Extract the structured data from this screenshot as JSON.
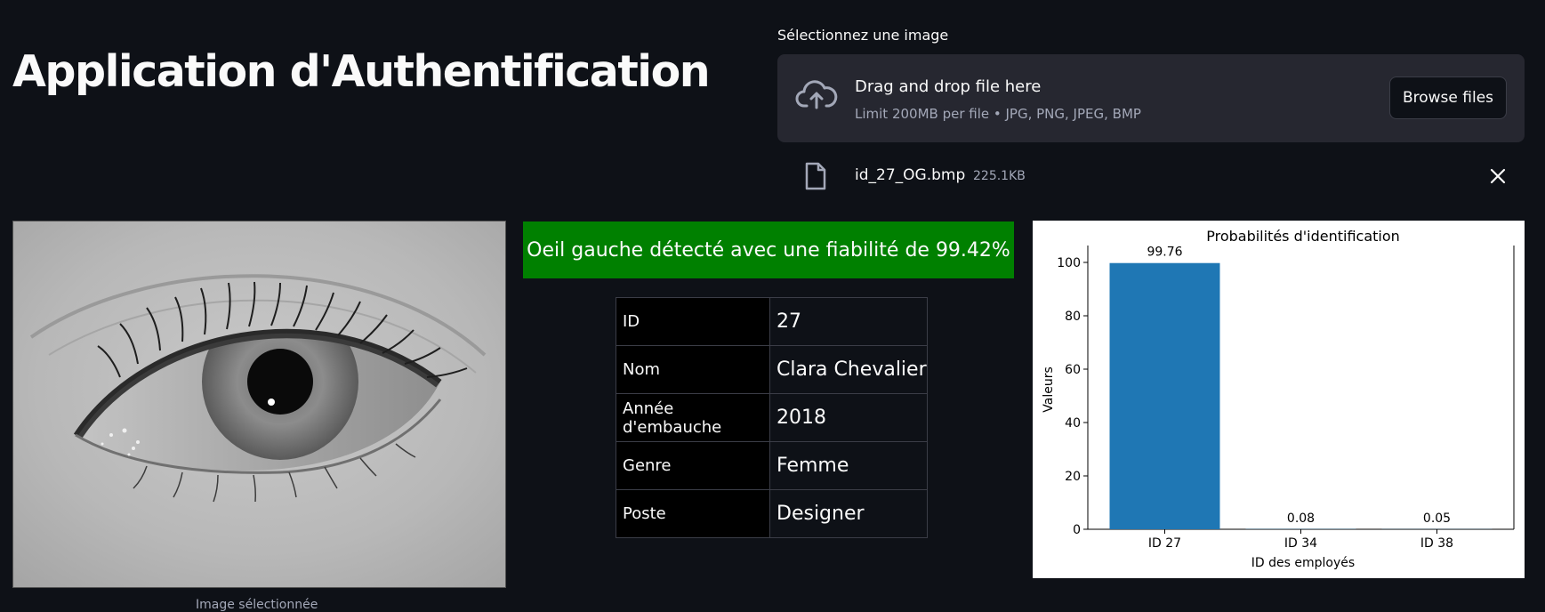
{
  "page": {
    "title": "Application d'Authentification"
  },
  "uploader": {
    "label": "Sélectionnez une image",
    "drop_title": "Drag and drop file here",
    "drop_sub": "Limit 200MB per file • JPG, PNG, JPEG, BMP",
    "browse_label": "Browse files",
    "file": {
      "name": "id_27_OG.bmp",
      "size": "225.1KB"
    }
  },
  "image": {
    "caption": "Image sélectionnée"
  },
  "result": {
    "message": "Oeil gauche détecté avec une fiabilité de 99.42%",
    "color": "#008000"
  },
  "employee": {
    "rows": [
      {
        "key": "ID",
        "value": "27"
      },
      {
        "key": "Nom",
        "value": "Clara Chevalier"
      },
      {
        "key": "Année d'embauche",
        "value": "2018"
      },
      {
        "key": "Genre",
        "value": "Femme"
      },
      {
        "key": "Poste",
        "value": "Designer"
      }
    ]
  },
  "chart_data": {
    "type": "bar",
    "title": "Probabilités d'identification",
    "xlabel": "ID des employés",
    "ylabel": "Valeurs",
    "categories": [
      "ID 27",
      "ID 34",
      "ID 38"
    ],
    "values": [
      99.76,
      0.08,
      0.05
    ],
    "value_labels": [
      "99.76",
      "0.08",
      "0.05"
    ],
    "ylim": [
      0,
      100
    ],
    "yticks": [
      "0",
      "20",
      "40",
      "60",
      "80",
      "100"
    ],
    "bar_color": "#1f77b4",
    "grid": false
  }
}
